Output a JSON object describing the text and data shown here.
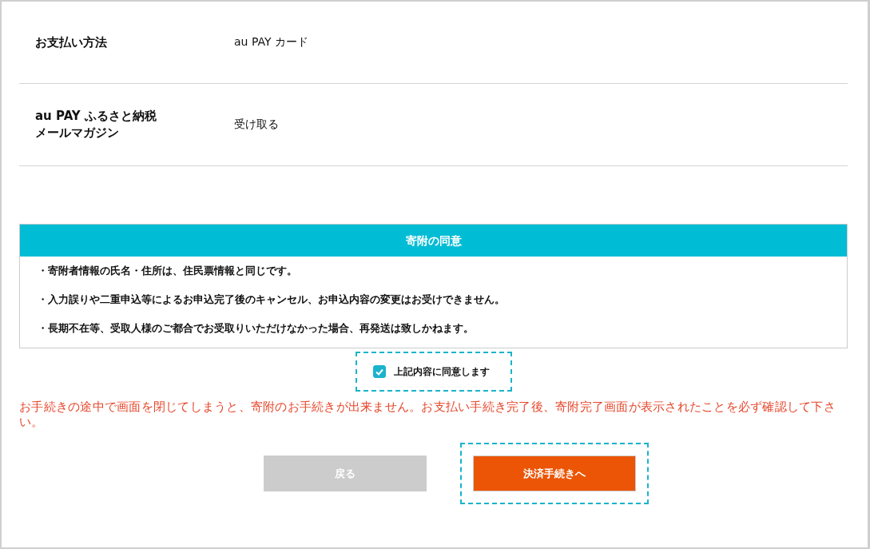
{
  "details": [
    {
      "label": "お支払い方法",
      "value": "au PAY カード"
    },
    {
      "label": "au PAY ふるさと納税メールマガジン",
      "value": "受け取る"
    }
  ],
  "consent": {
    "title": "寄附の同意",
    "items": [
      "・寄附者情報の氏名・住所は、住民票情報と同じです。",
      "・入力誤りや二重申込等によるお申込完了後のキャンセル、お申込内容の変更はお受けできません。",
      "・長期不在等、受取人様のご都合でお受取りいただけなかった場合、再発送は致しかねます。"
    ]
  },
  "agree": {
    "label": "上記内容に同意します",
    "checked": true,
    "highlighted": true
  },
  "warning": "お手続きの途中で画面を閉じてしまうと、寄附のお手続きが出来ません。お支払い手続き完了後、寄附完了画面が表示されたことを必ず確認して下さい。",
  "buttons": [
    {
      "kind": "back",
      "label": "戻る"
    },
    {
      "kind": "next",
      "label": "決済手続きへ",
      "highlighted": true
    }
  ]
}
